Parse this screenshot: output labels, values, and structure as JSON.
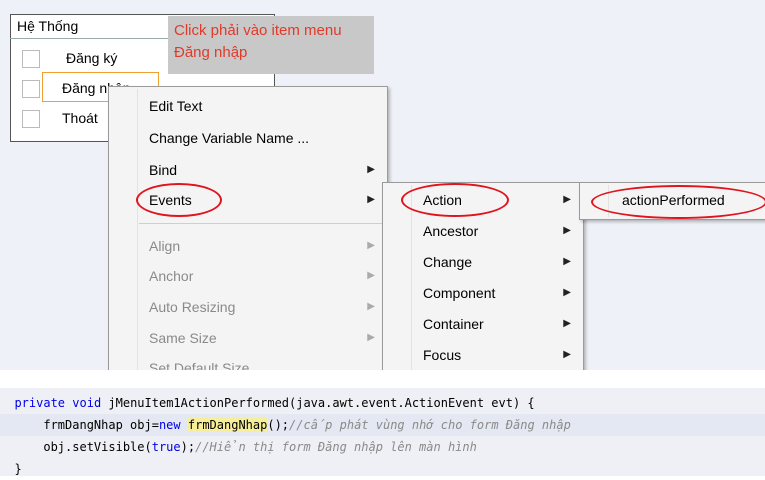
{
  "designer": {
    "menu_title": "Hệ Thống",
    "menu_items": [
      {
        "label": "Đăng ký"
      },
      {
        "label": "Đăng nhập"
      },
      {
        "label": "Thoát"
      }
    ],
    "hint_text": "Click phải vào item menu Đăng nhập"
  },
  "context_menu": {
    "items": [
      {
        "label": "Edit Text",
        "submenu": false,
        "disabled": false
      },
      {
        "label": "Change Variable Name ...",
        "submenu": false,
        "disabled": false
      },
      {
        "label": "Bind",
        "submenu": true,
        "disabled": false
      },
      {
        "label": "Events",
        "submenu": true,
        "disabled": false,
        "highlighted": true
      },
      {
        "label": "Align",
        "submenu": true,
        "disabled": true
      },
      {
        "label": "Anchor",
        "submenu": true,
        "disabled": true
      },
      {
        "label": "Auto Resizing",
        "submenu": true,
        "disabled": true
      },
      {
        "label": "Same Size",
        "submenu": true,
        "disabled": true
      },
      {
        "label": "Set Default Size",
        "submenu": false,
        "disabled": true
      }
    ]
  },
  "events_submenu": {
    "items": [
      {
        "label": "Action",
        "highlighted": true
      },
      {
        "label": "Ancestor"
      },
      {
        "label": "Change"
      },
      {
        "label": "Component"
      },
      {
        "label": "Container"
      },
      {
        "label": "Focus"
      }
    ]
  },
  "action_submenu": {
    "items": [
      {
        "label": "actionPerformed",
        "highlighted": true
      }
    ]
  },
  "code": {
    "line1": {
      "kw1": "private",
      "kw2": "void",
      "rest": " jMenuItem1ActionPerformed(java.awt.event.ActionEvent evt) {"
    },
    "line2": {
      "pre": "frmDangNhap obj=",
      "kw": "new",
      "hl": "frmDangNhap",
      "post": "();",
      "comment": "//cấp phát vùng nhớ cho form Đăng nhập"
    },
    "line3": {
      "pre": "obj.setVisible(",
      "kw": "true",
      "post": ");",
      "comment": "//Hiển thị form Đăng nhập lên màn hình"
    },
    "line4": {
      "text": "}"
    }
  },
  "colors": {
    "annotation": "#e0141e",
    "hint_text": "#e03a2a",
    "keyword": "#0000e6",
    "highlight": "#f7ee9a"
  },
  "icons": {
    "submenu_arrow": "▶"
  }
}
